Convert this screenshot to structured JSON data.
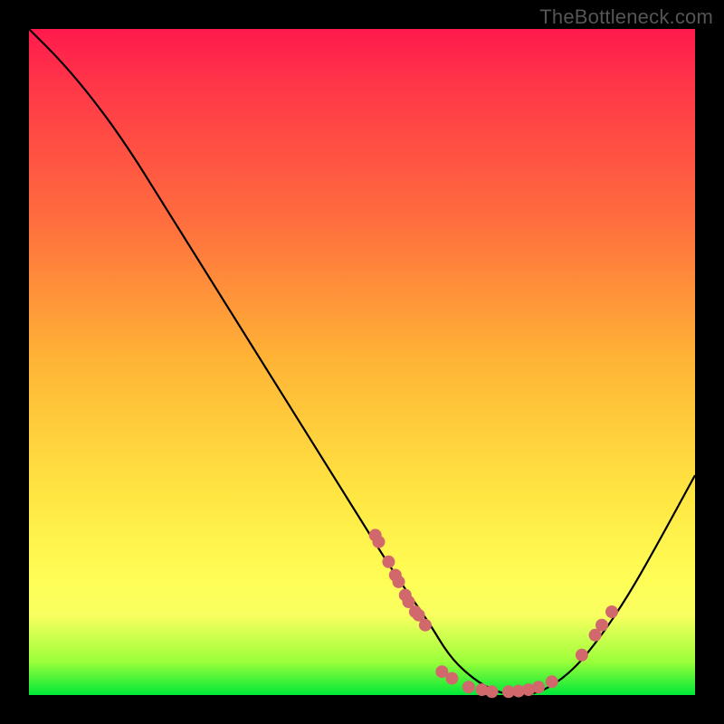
{
  "watermark": "TheBottleneck.com",
  "colors": {
    "dot": "#d1696c",
    "curve": "#000000"
  },
  "chart_data": {
    "type": "line",
    "title": "",
    "xlabel": "",
    "ylabel": "",
    "xlim": [
      0,
      100
    ],
    "ylim": [
      0,
      100
    ],
    "grid": false,
    "curve": {
      "comment": "x in 0..100, y is bottleneck % (0 = bottom/green, 100 = top/red). V-shaped valley min around x≈70.",
      "x": [
        0,
        5,
        10,
        15,
        20,
        25,
        30,
        35,
        40,
        45,
        50,
        55,
        60,
        63,
        66,
        69,
        72,
        75,
        78,
        82,
        86,
        90,
        94,
        100
      ],
      "y": [
        100,
        95,
        89,
        82,
        74,
        66,
        58,
        50,
        42,
        34,
        26,
        18,
        11,
        6,
        3,
        1,
        0,
        0,
        1,
        4,
        9,
        15,
        22,
        33
      ]
    },
    "series": [
      {
        "name": "markers-left",
        "comment": "cluster of points on the descending left wall of the valley",
        "x": [
          52,
          52.5,
          54,
          55,
          55.5,
          56.5,
          57,
          58,
          58.5,
          59.5
        ],
        "y": [
          24,
          23,
          20,
          18,
          17,
          15,
          14,
          12.5,
          12,
          10.5
        ]
      },
      {
        "name": "markers-bottom",
        "comment": "points scattered along the valley floor",
        "x": [
          62,
          63.5,
          66,
          68,
          69.5,
          72,
          73.5,
          75,
          76.5,
          78.5
        ],
        "y": [
          3.5,
          2.5,
          1.2,
          0.8,
          0.5,
          0.5,
          0.6,
          0.8,
          1.2,
          2
        ]
      },
      {
        "name": "markers-right",
        "comment": "cluster of points on the ascending right wall",
        "x": [
          83,
          85,
          86,
          87.5
        ],
        "y": [
          6,
          9,
          10.5,
          12.5
        ]
      }
    ]
  }
}
